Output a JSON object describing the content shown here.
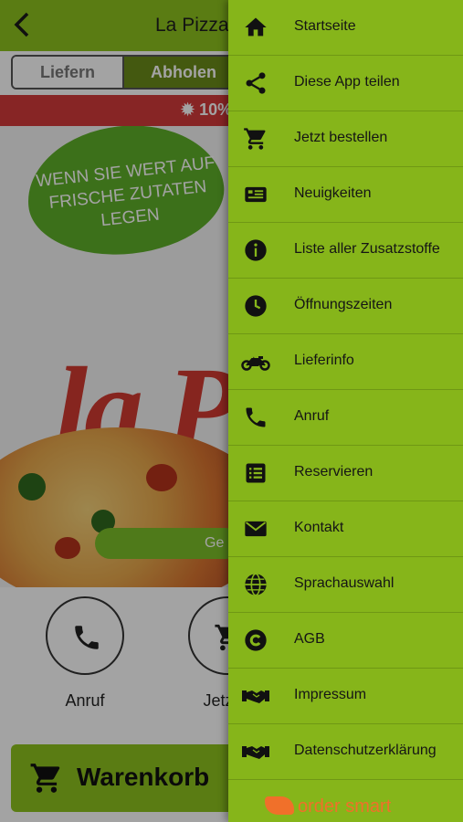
{
  "header": {
    "title": "La Pizza",
    "back_icon": "chevron-left-icon"
  },
  "order_mode": {
    "options": [
      "Liefern",
      "Abholen"
    ],
    "selected": "Abholen"
  },
  "promo": {
    "text": "10%"
  },
  "hero": {
    "leaf_text": "WENN SIE WERT AUF FRISCHE ZUTATEN LEGEN",
    "logo_text": "la P",
    "button_text": "Ge"
  },
  "actions": [
    {
      "label": "Anruf",
      "icon": "phone-icon"
    },
    {
      "label": "Jetzt b",
      "icon": "cart-icon"
    }
  ],
  "cart": {
    "label": "Warenkorb",
    "icon": "cart-icon"
  },
  "drawer": {
    "items": [
      {
        "label": "Startseite",
        "icon": "home-icon"
      },
      {
        "label": "Diese App teilen",
        "icon": "share-icon"
      },
      {
        "label": "Jetzt bestellen",
        "icon": "cart-icon"
      },
      {
        "label": "Neuigkeiten",
        "icon": "newspaper-icon"
      },
      {
        "label": "Liste aller Zusatzstoffe",
        "icon": "info-icon"
      },
      {
        "label": "Öffnungszeiten",
        "icon": "clock-icon"
      },
      {
        "label": "Lieferinfo",
        "icon": "motorcycle-icon"
      },
      {
        "label": "Anruf",
        "icon": "phone-icon"
      },
      {
        "label": "Reservieren",
        "icon": "list-icon"
      },
      {
        "label": "Kontakt",
        "icon": "envelope-icon"
      },
      {
        "label": "Sprachauswahl",
        "icon": "globe-icon"
      },
      {
        "label": "AGB",
        "icon": "copyright-icon"
      },
      {
        "label": "Impressum",
        "icon": "handshake-icon"
      },
      {
        "label": "Datenschutzerklärung",
        "icon": "handshake-icon"
      }
    ],
    "footer_logo": "order smart"
  },
  "colors": {
    "brand_green": "#8dc21f",
    "drawer_green": "#86b51a",
    "promo_red": "#d43a3a",
    "logo_orange": "#f0702a"
  }
}
